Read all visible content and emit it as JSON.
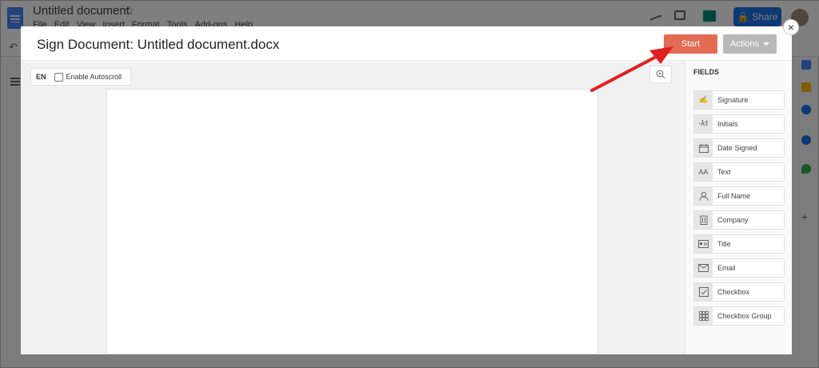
{
  "background_app": {
    "title": "Untitled document",
    "menu": [
      "File",
      "Edit",
      "View",
      "Insert",
      "Format",
      "Tools",
      "Add-ons",
      "Help"
    ],
    "share_label": "Share"
  },
  "modal": {
    "title": "Sign Document: Untitled document.docx",
    "start_label": "Start",
    "actions_label": "Actions",
    "close_glyph": "×"
  },
  "toolbar": {
    "language": "EN",
    "autoscroll_label": "Enable Autoscroll"
  },
  "fields": {
    "heading": "FIELDS",
    "items": [
      {
        "label": "Signature",
        "icon": "signature-icon"
      },
      {
        "label": "Initials",
        "icon": "initials-icon"
      },
      {
        "label": "Date Signed",
        "icon": "calendar-icon"
      },
      {
        "label": "Text",
        "icon": "text-icon"
      },
      {
        "label": "Full Name",
        "icon": "person-icon"
      },
      {
        "label": "Company",
        "icon": "building-icon"
      },
      {
        "label": "Title",
        "icon": "id-card-icon"
      },
      {
        "label": "Email",
        "icon": "envelope-icon"
      },
      {
        "label": "Checkbox",
        "icon": "checkbox-icon"
      },
      {
        "label": "Checkbox Group",
        "icon": "grid-dots-icon"
      }
    ]
  },
  "colors": {
    "start_button": "#e36b54",
    "actions_button": "#b8b8b8",
    "annotation_arrow": "#e02020"
  }
}
